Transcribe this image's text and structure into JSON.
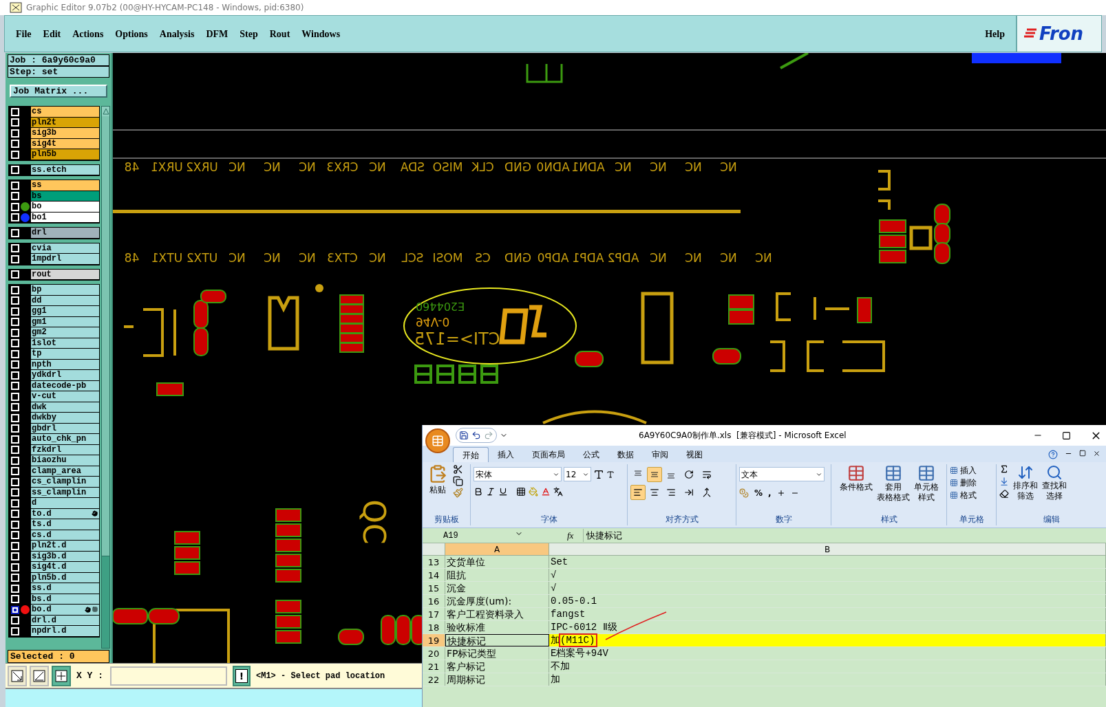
{
  "window": {
    "title": "Graphic Editor 9.07b2 (00@HY-HYCAM-PC148 - Windows, pid:6380)"
  },
  "menu": {
    "items": [
      "File",
      "Edit",
      "Actions",
      "Options",
      "Analysis",
      "DFM",
      "Step",
      "Rout",
      "Windows"
    ],
    "help": "Help",
    "logo": "Fron"
  },
  "job_panel": {
    "job": "Job : 6a9y60c9a0",
    "step": "Step: set",
    "matrix_button": "Job Matrix ...",
    "selected_count": "Selected : 0",
    "layer_groups": [
      [
        {
          "name": "cs",
          "color": "#ffc65c",
          "selected": false,
          "hand": false,
          "grid": false
        },
        {
          "name": "pln2t",
          "color": "#d9a406",
          "selected": false,
          "hand": false,
          "grid": false
        },
        {
          "name": "sig3b",
          "color": "#ffc65c",
          "selected": false,
          "hand": false,
          "grid": false
        },
        {
          "name": "sig4t",
          "color": "#ffc65c",
          "selected": false,
          "hand": false,
          "grid": false
        },
        {
          "name": "pln5b",
          "color": "#d9a406",
          "selected": false,
          "hand": false,
          "grid": false
        }
      ],
      [
        {
          "name": "ss.etch",
          "color": "#a3dcdc",
          "selected": false,
          "hand": false,
          "grid": false
        }
      ],
      [
        {
          "name": "ss",
          "color": "#ffc65c",
          "selected": false,
          "hand": false,
          "grid": false
        },
        {
          "name": "bs",
          "color": "#009e7a",
          "selected": false,
          "hand": false,
          "grid": false
        },
        {
          "name": "bo",
          "color": "#ffffff",
          "selected": false,
          "hand": false,
          "grid": false,
          "dot": {
            "color": "#3c9a10"
          }
        },
        {
          "name": "bo1",
          "color": "#ffffff",
          "selected": false,
          "hand": false,
          "grid": false,
          "dot": {
            "color": "#1030ff"
          }
        }
      ],
      [
        {
          "name": "drl",
          "color": "#a0b2ba",
          "selected": false,
          "hand": false,
          "grid": false
        }
      ],
      [
        {
          "name": "cvia",
          "color": "#a3dcdc",
          "selected": false,
          "hand": false,
          "grid": false
        },
        {
          "name": "1mpdrl",
          "color": "#a3dcdc",
          "selected": false,
          "hand": false,
          "grid": false
        }
      ],
      [
        {
          "name": "rout",
          "color": "#d6d6d6",
          "selected": false,
          "hand": false,
          "grid": false
        }
      ],
      [
        {
          "name": "bp",
          "color": "#a3dcdc",
          "selected": false,
          "hand": false,
          "grid": false
        },
        {
          "name": "dd",
          "color": "#a3dcdc",
          "selected": false,
          "hand": false,
          "grid": false
        },
        {
          "name": "gg1",
          "color": "#a3dcdc",
          "selected": false,
          "hand": false,
          "grid": false
        },
        {
          "name": "gm1",
          "color": "#a3dcdc",
          "selected": false,
          "hand": false,
          "grid": false
        },
        {
          "name": "gm2",
          "color": "#a3dcdc",
          "selected": false,
          "hand": false,
          "grid": false
        },
        {
          "name": "1slot",
          "color": "#a3dcdc",
          "selected": false,
          "hand": false,
          "grid": false
        },
        {
          "name": "tp",
          "color": "#a3dcdc",
          "selected": false,
          "hand": false,
          "grid": false
        },
        {
          "name": "npth",
          "color": "#a3dcdc",
          "selected": false,
          "hand": false,
          "grid": false
        },
        {
          "name": "ydkdrl",
          "color": "#a3dcdc",
          "selected": false,
          "hand": false,
          "grid": false
        },
        {
          "name": "datecode-pb",
          "color": "#a3dcdc",
          "selected": false,
          "hand": false,
          "grid": false
        },
        {
          "name": "v-cut",
          "color": "#a3dcdc",
          "selected": false,
          "hand": false,
          "grid": false
        },
        {
          "name": "dwk",
          "color": "#a3dcdc",
          "selected": false,
          "hand": false,
          "grid": false
        },
        {
          "name": "dwkby",
          "color": "#a3dcdc",
          "selected": false,
          "hand": false,
          "grid": false
        },
        {
          "name": "gbdrl",
          "color": "#a3dcdc",
          "selected": false,
          "hand": false,
          "grid": false
        },
        {
          "name": "auto_chk_pn",
          "color": "#a3dcdc",
          "selected": false,
          "hand": false,
          "grid": false
        },
        {
          "name": "fzkdrl",
          "color": "#a3dcdc",
          "selected": false,
          "hand": false,
          "grid": false
        },
        {
          "name": "biaozhu",
          "color": "#a3dcdc",
          "selected": false,
          "hand": false,
          "grid": false
        },
        {
          "name": "clamp_area",
          "color": "#a3dcdc",
          "selected": false,
          "hand": false,
          "grid": false
        },
        {
          "name": "cs_clamplin",
          "color": "#a3dcdc",
          "selected": false,
          "hand": false,
          "grid": false
        },
        {
          "name": "ss_clamplin",
          "color": "#a3dcdc",
          "selected": false,
          "hand": false,
          "grid": false
        },
        {
          "name": "d",
          "color": "#a3dcdc",
          "selected": false,
          "hand": false,
          "grid": false
        },
        {
          "name": "to.d",
          "color": "#a3dcdc",
          "selected": false,
          "hand": true,
          "grid": false
        },
        {
          "name": "ts.d",
          "color": "#a3dcdc",
          "selected": false,
          "hand": false,
          "grid": false
        },
        {
          "name": "cs.d",
          "color": "#a3dcdc",
          "selected": false,
          "hand": false,
          "grid": false
        },
        {
          "name": "pln2t.d",
          "color": "#a3dcdc",
          "selected": false,
          "hand": false,
          "grid": false
        },
        {
          "name": "sig3b.d",
          "color": "#a3dcdc",
          "selected": false,
          "hand": false,
          "grid": false
        },
        {
          "name": "sig4t.d",
          "color": "#a3dcdc",
          "selected": false,
          "hand": false,
          "grid": false
        },
        {
          "name": "pln5b.d",
          "color": "#a3dcdc",
          "selected": false,
          "hand": false,
          "grid": false
        },
        {
          "name": "ss.d",
          "color": "#a3dcdc",
          "selected": false,
          "hand": false,
          "grid": false
        },
        {
          "name": "bs.d",
          "color": "#a3dcdc",
          "selected": false,
          "hand": false,
          "grid": false
        },
        {
          "name": "bo.d",
          "color": "#a3dcdc",
          "selected": true,
          "hand": true,
          "grid": true,
          "dot": {
            "color": "#f01010"
          }
        },
        {
          "name": "drl.d",
          "color": "#a3dcdc",
          "selected": false,
          "hand": false,
          "grid": false
        },
        {
          "name": "npdrl.d",
          "color": "#a3dcdc",
          "selected": false,
          "hand": false,
          "grid": false
        }
      ]
    ]
  },
  "canvas": {
    "pin_rows": [
      [
        "48",
        "URX1",
        "URX2",
        "NC",
        "NC",
        "NC",
        "CRX3",
        "NC",
        "SDA",
        "MISO",
        "CLK",
        "GND",
        "ADN0",
        "ADN1",
        "NC",
        "NC",
        "NC",
        "NC"
      ],
      [
        "48",
        "UTX1",
        "UTX2",
        "NC",
        "NC",
        "NC",
        "CTX3",
        "NC",
        "SCL",
        "MOSI",
        "CS",
        "GND",
        "ADP0",
        "ADP1",
        "ADP2",
        "NC",
        "NC",
        "NC",
        "NC"
      ]
    ],
    "markings": [
      "E204460",
      "94V-0",
      "CTI>=175"
    ],
    "oval_label": "QC"
  },
  "command_bar": {
    "xy_label": "X Y :",
    "alert": "!",
    "message": "<M1> - Select pad location"
  },
  "excel": {
    "title": "6A9Y60C9A0制作单.xls  [兼容模式] - Microsoft Excel",
    "tabs": [
      {
        "label": "开始",
        "selected": true
      },
      {
        "label": "插入",
        "selected": false
      },
      {
        "label": "页面布局",
        "selected": false
      },
      {
        "label": "公式",
        "selected": false
      },
      {
        "label": "数据",
        "selected": false
      },
      {
        "label": "审阅",
        "selected": false
      },
      {
        "label": "视图",
        "selected": false
      }
    ],
    "ribbon": {
      "clipboard": {
        "paste": "粘贴",
        "label": "剪贴板"
      },
      "font": {
        "name": "宋体",
        "size": "12",
        "label": "字体"
      },
      "alignment": {
        "label": "对齐方式",
        "vertical": [
          {
            "selected": false
          },
          {
            "selected": true
          },
          {
            "selected": false
          }
        ],
        "horizontal": [
          {
            "selected": true
          },
          {
            "selected": false
          },
          {
            "selected": false
          }
        ]
      },
      "number": {
        "format": "文本",
        "buttons": [
          "%",
          ","
        ],
        "label": "数字"
      },
      "styles": {
        "buttons": [
          [
            "条件格式"
          ],
          [
            "套用",
            "表格格式"
          ],
          [
            "单元格",
            "样式"
          ]
        ],
        "label": "样式"
      },
      "cells": {
        "buttons": [
          "插入",
          "删除",
          "格式"
        ],
        "label": "单元格"
      },
      "editing": {
        "buttons": [
          [
            "排序和",
            "筛选"
          ],
          [
            "查找和",
            "选择"
          ]
        ],
        "label": "编辑"
      }
    },
    "name_box": "A19",
    "function_label": "fx",
    "formula": "快捷标记",
    "columns": [
      {
        "label": "A",
        "selected": true
      },
      {
        "label": "B",
        "selected": false
      }
    ],
    "rows": [
      {
        "number": "13",
        "cells": [
          "交货单位",
          "Set"
        ],
        "selected": false
      },
      {
        "number": "14",
        "cells": [
          "阻抗",
          "√"
        ],
        "selected": false
      },
      {
        "number": "15",
        "cells": [
          "沉金",
          "√"
        ],
        "selected": false
      },
      {
        "number": "16",
        "cells": [
          "沉金厚度(um):",
          "0.05-0.1"
        ],
        "selected": false
      },
      {
        "number": "17",
        "cells": [
          "客户工程资料录入",
          "fangst"
        ],
        "selected": false
      },
      {
        "number": "18",
        "cells": [
          "验收标准",
          "IPC-6012 Ⅱ级"
        ],
        "selected": false
      },
      {
        "number": "19",
        "cells": [
          "快捷标记",
          "加(M11C)"
        ],
        "selected": true
      },
      {
        "number": "20",
        "cells": [
          "FP标记类型",
          "E档案号+94V"
        ],
        "selected": false
      },
      {
        "number": "21",
        "cells": [
          "客户标记",
          "不加"
        ],
        "selected": false
      },
      {
        "number": "22",
        "cells": [
          "周期标记",
          "加"
        ],
        "selected": false
      }
    ]
  }
}
